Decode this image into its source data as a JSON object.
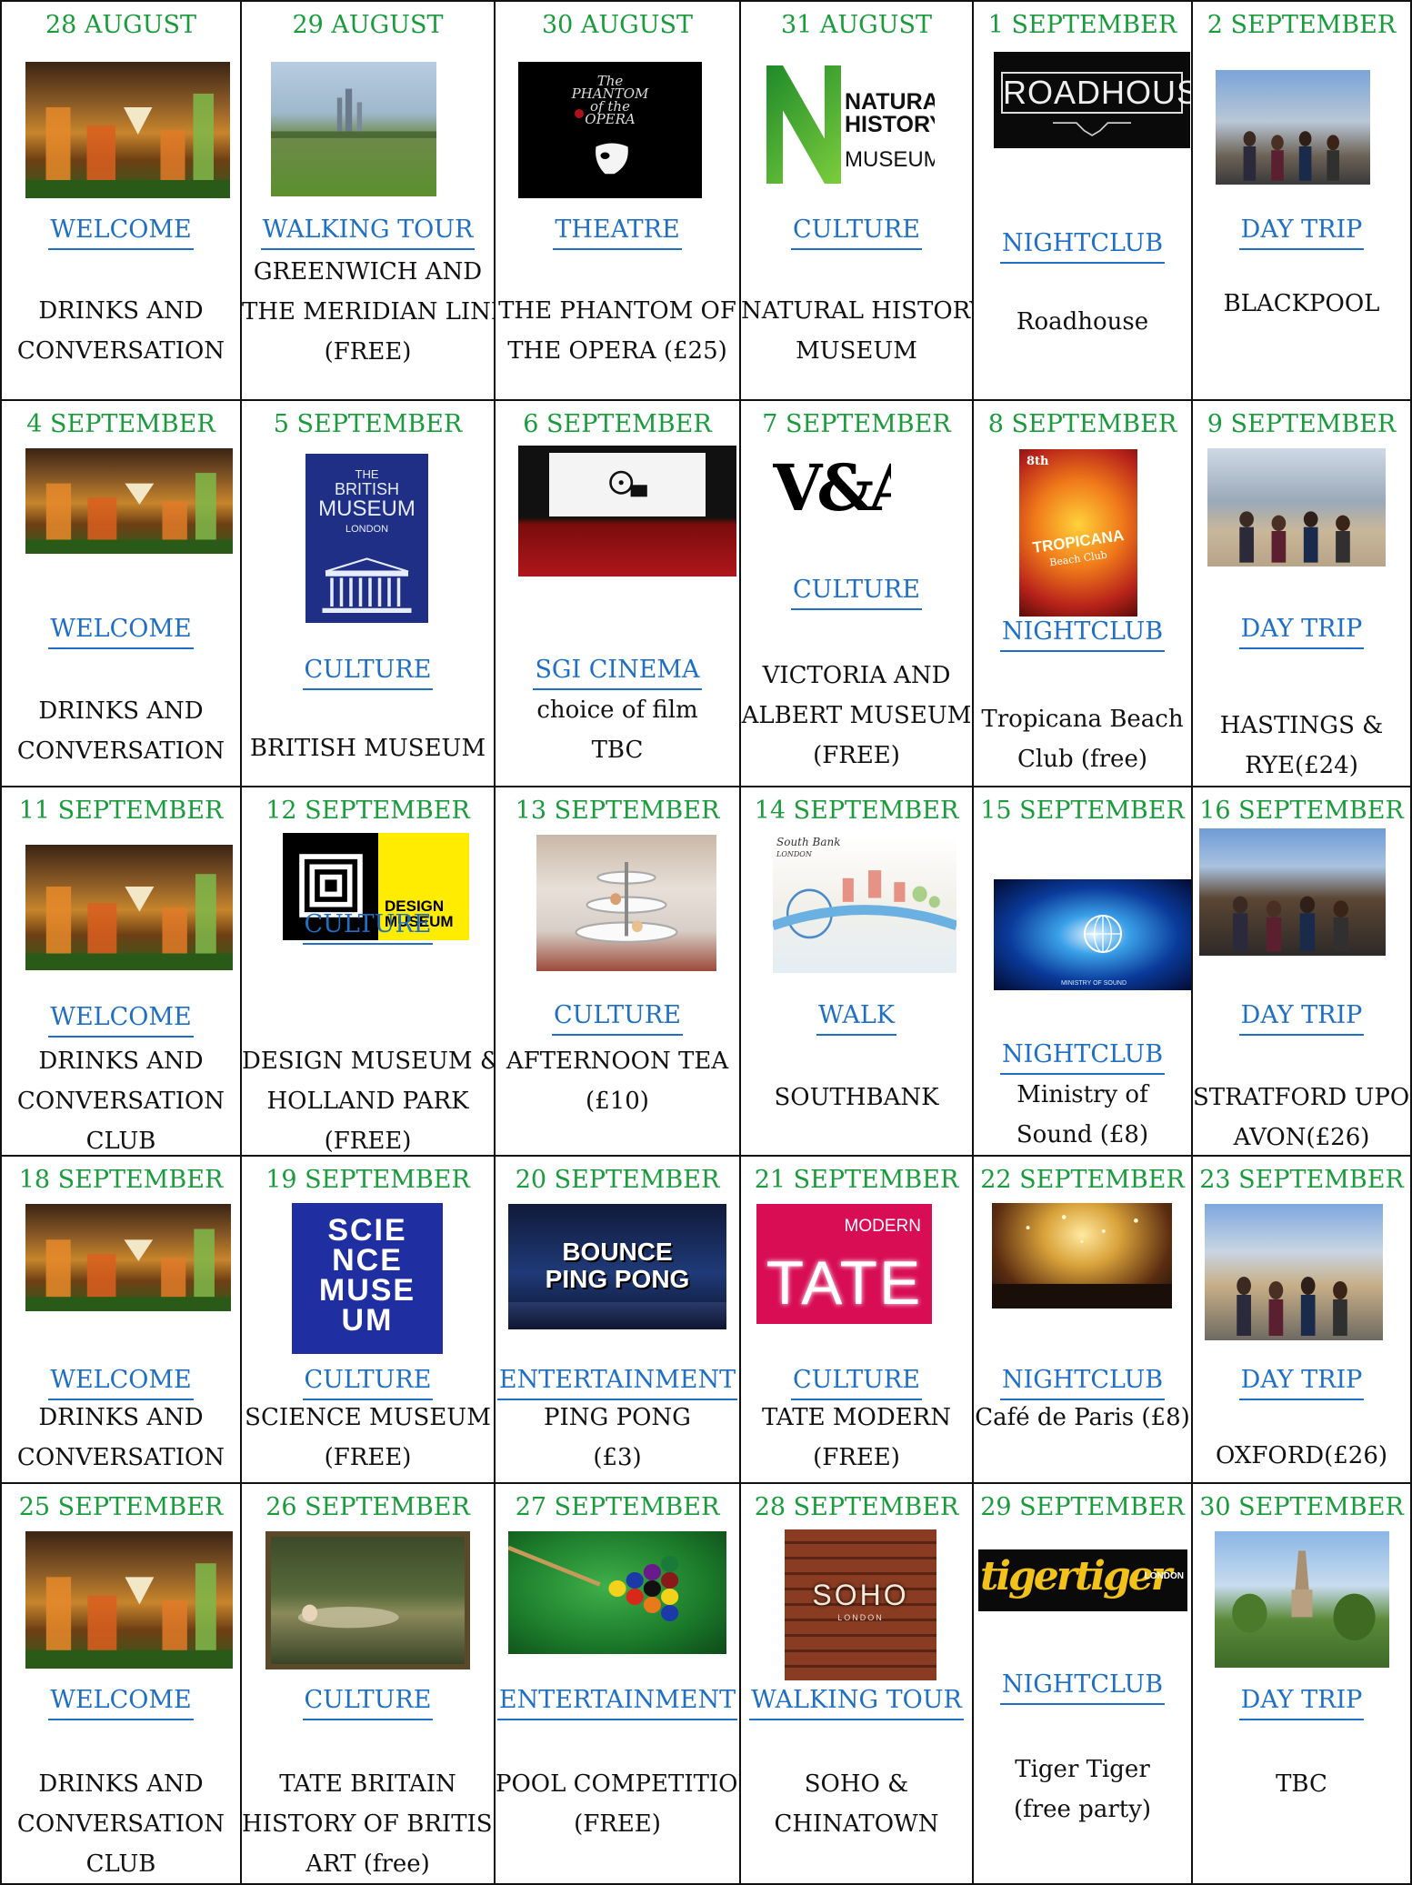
{
  "colors": {
    "date": "#1a9b3c",
    "category": "#1f6fc4",
    "text": "#111111"
  },
  "weeks": [
    [
      {
        "date": "28 AUGUST",
        "image": "cocktails-photo",
        "category": "WELCOME",
        "lines": [
          "DRINKS AND",
          "CONVERSATION"
        ]
      },
      {
        "date": "29 AUGUST",
        "image": "greenwich-park-photo",
        "category": "WALKING TOUR",
        "lines": [
          "GREENWICH AND",
          "THE MERIDIAN LINE",
          "(FREE)"
        ]
      },
      {
        "date": "30 AUGUST",
        "image": "phantom-of-the-opera-logo",
        "image_text": [
          "The",
          "PHANTOM",
          "of the",
          "OPERA"
        ],
        "category": "THEATRE",
        "lines": [
          "THE PHANTOM OF",
          "THE OPERA (£25)"
        ]
      },
      {
        "date": "31 AUGUST",
        "image": "natural-history-museum-logo",
        "image_text": [
          "NATURAL",
          "HISTORY",
          "MUSEUM"
        ],
        "category": "CULTURE",
        "lines": [
          "NATURAL HISTORY",
          "MUSEUM"
        ]
      },
      {
        "date": "1 SEPTEMBER",
        "image": "roadhouse-logo",
        "image_text": [
          "ROADHOUSE"
        ],
        "category": "NIGHTCLUB",
        "lines": [
          "Roadhouse"
        ]
      },
      {
        "date": "2 SEPTEMBER",
        "image": "blackpool-group-photo",
        "category": "DAY TRIP",
        "lines": [
          "BLACKPOOL"
        ]
      }
    ],
    [
      {
        "date": "4 SEPTEMBER",
        "image": "cocktails-photo",
        "category": "WELCOME",
        "lines": [
          "DRINKS AND",
          "CONVERSATION"
        ]
      },
      {
        "date": "5 SEPTEMBER",
        "image": "british-museum-guidebook",
        "image_text": [
          "THE",
          "BRITISH",
          "MUSEUM",
          "LONDON"
        ],
        "category": "CULTURE",
        "lines": [
          "BRITISH MUSEUM"
        ]
      },
      {
        "date": "6 SEPTEMBER",
        "image": "cinema-screen-illustration",
        "category": "SGI CINEMA",
        "lines": [
          "choice of film",
          "TBC"
        ]
      },
      {
        "date": "7 SEPTEMBER",
        "image": "v-and-a-logo",
        "image_text": [
          "V&A"
        ],
        "category": "CULTURE",
        "lines": [
          "VICTORIA AND",
          "ALBERT MUSEUM",
          "(FREE)"
        ]
      },
      {
        "date": "8 SEPTEMBER",
        "image": "tropicana-poster",
        "image_text": [
          "8th",
          "TROPICANA",
          "Beach Club"
        ],
        "category": "NIGHTCLUB",
        "lines": [
          "Tropicana Beach",
          "Club (free)"
        ]
      },
      {
        "date": "9 SEPTEMBER",
        "image": "hastings-beach-photo",
        "category": "DAY TRIP",
        "lines": [
          "HASTINGS &",
          "RYE(£24)"
        ]
      }
    ],
    [
      {
        "date": "11 SEPTEMBER",
        "image": "cocktails-photo",
        "category": "WELCOME",
        "lines": [
          "DRINKS AND",
          "CONVERSATION",
          "CLUB"
        ]
      },
      {
        "date": "12 SEPTEMBER",
        "image": "design-museum-logo",
        "image_text": [
          "DESIGN",
          "MUSEUM"
        ],
        "category": "CULTURE",
        "lines": [
          "DESIGN MUSEUM &",
          "HOLLAND PARK",
          "(FREE)"
        ]
      },
      {
        "date": "13 SEPTEMBER",
        "image": "afternoon-tea-photo",
        "category": "CULTURE",
        "lines": [
          "AFTERNOON TEA",
          "(£10)"
        ]
      },
      {
        "date": "14 SEPTEMBER",
        "image": "south-bank-illustration",
        "image_text": [
          "South Bank",
          "LONDON"
        ],
        "category": "WALK",
        "lines": [
          "SOUTHBANK"
        ]
      },
      {
        "date": "15 SEPTEMBER",
        "image": "ministry-of-sound-photo",
        "image_text": [
          "MINISTRY OF SOUND"
        ],
        "category": "NIGHTCLUB",
        "lines": [
          "Ministry of",
          "Sound (£8)"
        ]
      },
      {
        "date": "16 SEPTEMBER",
        "image": "stratford-group-photo",
        "category": "DAY TRIP",
        "lines": [
          "STRATFORD UPON",
          "AVON(£26)"
        ]
      }
    ],
    [
      {
        "date": "18 SEPTEMBER",
        "image": "cocktails-photo",
        "category": "WELCOME",
        "lines": [
          "DRINKS AND",
          "CONVERSATION"
        ]
      },
      {
        "date": "19 SEPTEMBER",
        "image": "science-museum-logo",
        "image_text": [
          "SCIE",
          "NCE",
          "MUSE",
          "UM"
        ],
        "category": "CULTURE",
        "lines": [
          "SCIENCE MUSEUM",
          "(FREE)"
        ]
      },
      {
        "date": "20 SEPTEMBER",
        "image": "bounce-ping-pong-photo",
        "image_text": [
          "BOUNCE",
          "PING PONG"
        ],
        "category": "ENTERTAINMENT",
        "lines": [
          "PING PONG",
          "(£3)"
        ]
      },
      {
        "date": "21 SEPTEMBER",
        "image": "tate-modern-logo",
        "image_text": [
          "MODERN",
          "TATE"
        ],
        "category": "CULTURE",
        "lines": [
          "TATE MODERN",
          "(FREE)"
        ]
      },
      {
        "date": "22 SEPTEMBER",
        "image": "cafe-de-paris-crowd-photo",
        "category": "NIGHTCLUB",
        "lines": [
          "Café de Paris  (£8)"
        ]
      },
      {
        "date": "23 SEPTEMBER",
        "image": "oxford-group-photo",
        "category": "DAY TRIP",
        "lines": [
          "OXFORD(£26)"
        ]
      }
    ],
    [
      {
        "date": "25 SEPTEMBER",
        "image": "cocktails-photo",
        "category": "WELCOME",
        "lines": [
          "DRINKS AND",
          "CONVERSATION",
          "CLUB"
        ]
      },
      {
        "date": "26 SEPTEMBER",
        "image": "ophelia-painting",
        "category": "CULTURE",
        "lines": [
          "TATE BRITAIN",
          "HISTORY OF BRITISH",
          "ART  (free)"
        ]
      },
      {
        "date": "27 SEPTEMBER",
        "image": "pool-balls-photo",
        "category": "ENTERTAINMENT",
        "lines": [
          "POOL COMPETITION",
          "(FREE)"
        ]
      },
      {
        "date": "28 SEPTEMBER",
        "image": "soho-brick-sign",
        "image_text": [
          "SOHO",
          "LONDON"
        ],
        "category": "WALKING TOUR",
        "lines": [
          "SOHO &",
          "CHINATOWN"
        ]
      },
      {
        "date": "29 SEPTEMBER",
        "image": "tiger-tiger-logo",
        "image_text": [
          "tigertiger",
          "LONDON"
        ],
        "category": "NIGHTCLUB",
        "lines": [
          "Tiger Tiger",
          "(free party)"
        ]
      },
      {
        "date": "30 SEPTEMBER",
        "image": "village-countryside-photo",
        "category": "DAY TRIP",
        "lines": [
          "TBC"
        ]
      }
    ]
  ]
}
